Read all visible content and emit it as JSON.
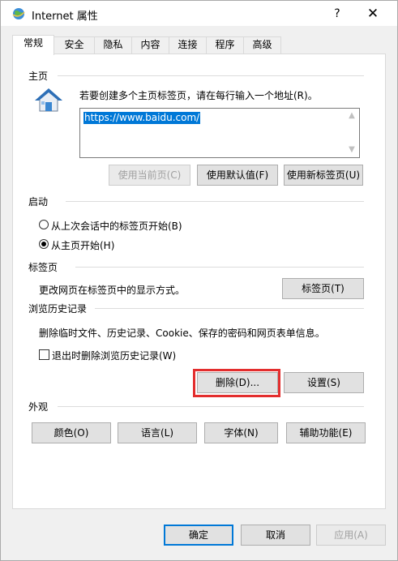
{
  "window": {
    "title": "Internet 属性",
    "help_glyph": "?",
    "close_glyph": "✕"
  },
  "tabs": [
    {
      "label": "常规",
      "active": true
    },
    {
      "label": "安全",
      "active": false
    },
    {
      "label": "隐私",
      "active": false
    },
    {
      "label": "内容",
      "active": false
    },
    {
      "label": "连接",
      "active": false
    },
    {
      "label": "程序",
      "active": false
    },
    {
      "label": "高级",
      "active": false
    }
  ],
  "home": {
    "title": "主页",
    "instruction": "若要创建多个主页标签页，请在每行输入一个地址(R)。",
    "url": "https://www.baidu.com/",
    "btn_current": "使用当前页(C)",
    "btn_default": "使用默认值(F)",
    "btn_newtab": "使用新标签页(U)"
  },
  "startup": {
    "title": "启动",
    "option_last": "从上次会话中的标签页开始(B)",
    "option_home": "从主页开始(H)",
    "selected": "home"
  },
  "tabs_section": {
    "title": "标签页",
    "desc": "更改网页在标签页中的显示方式。",
    "btn": "标签页(T)"
  },
  "history": {
    "title": "浏览历史记录",
    "desc": "删除临时文件、历史记录、Cookie、保存的密码和网页表单信息。",
    "checkbox_label": "退出时删除浏览历史记录(W)",
    "btn_delete": "删除(D)...",
    "btn_settings": "设置(S)"
  },
  "appearance": {
    "title": "外观",
    "btn_colors": "颜色(O)",
    "btn_languages": "语言(L)",
    "btn_fonts": "字体(N)",
    "btn_accessibility": "辅助功能(E)"
  },
  "footer": {
    "ok": "确定",
    "cancel": "取消",
    "apply": "应用(A)"
  },
  "colors": {
    "accent": "#0078d7",
    "highlight_box": "#e32d2d"
  }
}
